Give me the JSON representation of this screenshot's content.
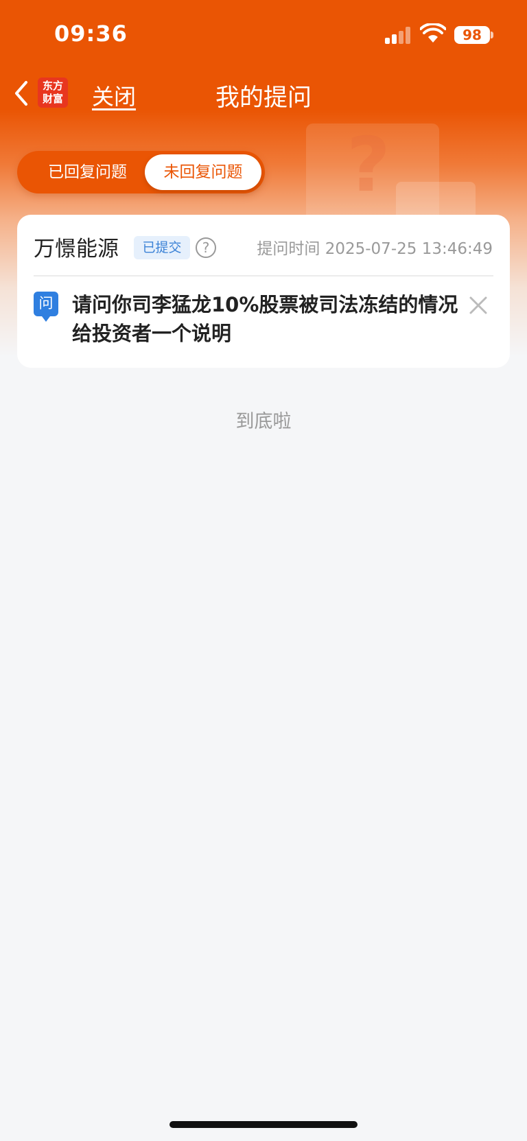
{
  "status_bar": {
    "time": "09:36",
    "battery": "98"
  },
  "nav": {
    "close_label": "关闭",
    "title": "我的提问",
    "logo_line1": "东方",
    "logo_line2": "财富"
  },
  "tabs": [
    {
      "label": "已回复问题",
      "selected": false
    },
    {
      "label": "未回复问题",
      "selected": true
    }
  ],
  "question_card": {
    "company": "万憬能源",
    "status": "已提交",
    "help": "?",
    "ask_time": "提问时间 2025-07-25 13:46:49",
    "q_badge": "问",
    "question": "请问你司李猛龙10%股票被司法冻结的情况给投资者一个说明"
  },
  "footer": {
    "end_text": "到底啦"
  },
  "colors": {
    "brand": "#ea5504",
    "badge_blue": "#2f7fe0"
  }
}
